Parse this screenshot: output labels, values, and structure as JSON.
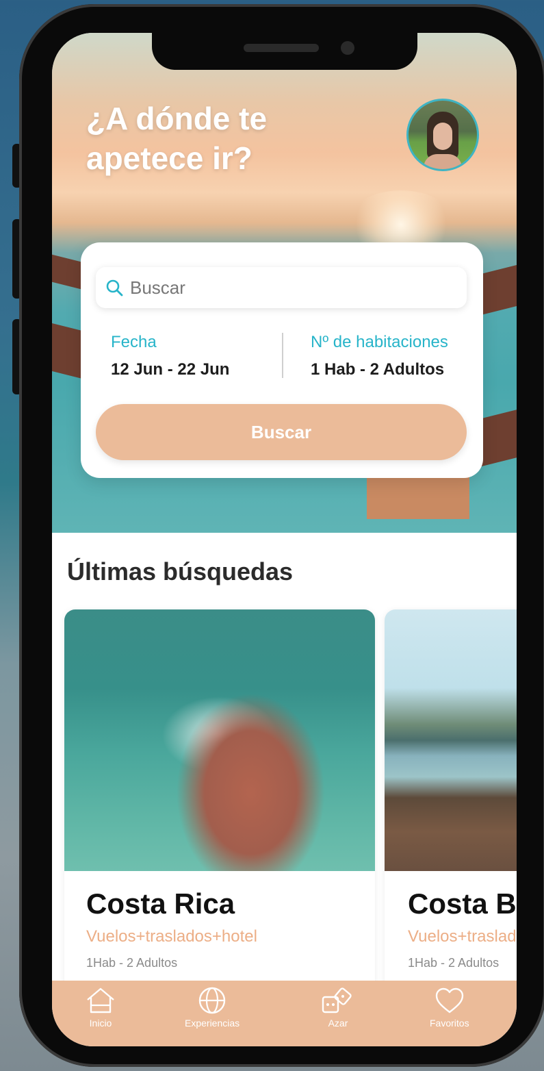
{
  "header": {
    "headline_line1": "¿A dónde te",
    "headline_line2": "apetece ir?"
  },
  "profile": {
    "avatar_icon": "user-photo"
  },
  "search_card": {
    "search_placeholder": "Buscar",
    "date_label": "Fecha",
    "date_value": "12 Jun - 22 Jun",
    "rooms_label": "Nº de habitaciones",
    "rooms_value": "1 Hab - 2 Adultos",
    "search_button": "Buscar"
  },
  "recent": {
    "title": "Últimas búsquedas",
    "items": [
      {
        "name": "Costa Rica",
        "package": "Vuelos+traslados+hotel",
        "guests": "1Hab - 2 Adultos"
      },
      {
        "name": "Costa Brava",
        "package": "Vuelos+traslados+hotel",
        "guests": "1Hab - 2 Adultos"
      }
    ]
  },
  "tabbar": {
    "tabs": [
      {
        "label": "Inicio",
        "icon": "home-icon"
      },
      {
        "label": "Experiencias",
        "icon": "globe-icon"
      },
      {
        "label": "Azar",
        "icon": "dice-icon"
      },
      {
        "label": "Favoritos",
        "icon": "heart-icon"
      }
    ]
  },
  "colors": {
    "accent_teal": "#27b4c9",
    "accent_peach": "#ebbb99",
    "package_text": "#ecae86"
  }
}
